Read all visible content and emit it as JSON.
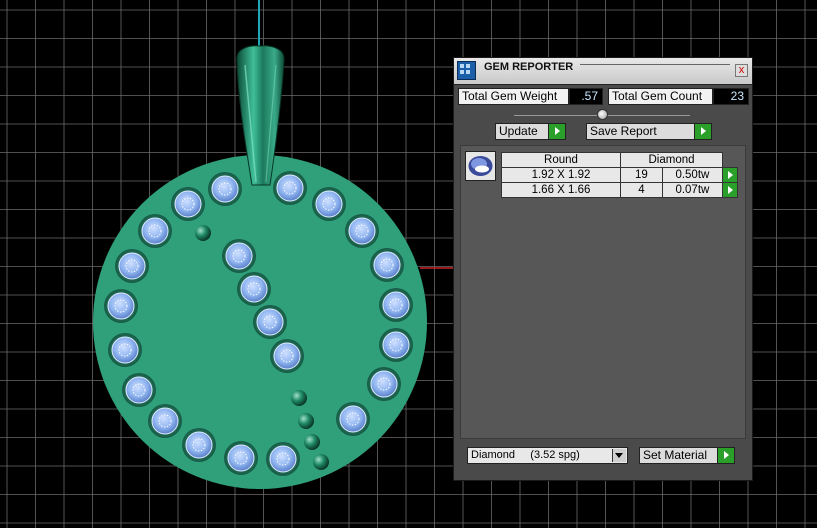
{
  "panel": {
    "title": "GEM REPORTER",
    "close_glyph": "x",
    "total_weight_label": "Total Gem Weight",
    "total_weight_value": ".57",
    "total_count_label": "Total Gem Count",
    "total_count_value": "23",
    "update_label": "Update",
    "save_report_label": "Save Report",
    "table": {
      "shape_header": "Round",
      "material_header": "Diamond",
      "rows": [
        {
          "size": "1.92 X 1.92",
          "count": "19",
          "weight": "0.50tw"
        },
        {
          "size": "1.66 X 1.66",
          "count": "4",
          "weight": "0.07tw"
        }
      ]
    },
    "material_select": "Diamond     (3.52 spg)",
    "set_material_label": "Set Material"
  },
  "colors": {
    "pendant": "#2fa07a",
    "gem": "#8fb4f0",
    "grid": "#6a6a6a",
    "panel_bg": "#4a4a4a",
    "go_button": "#2aa02a"
  },
  "icons": {
    "title": "gem-reporter-icon",
    "thumb": "gem-thumbnail-icon",
    "go": "play-arrow-icon"
  }
}
